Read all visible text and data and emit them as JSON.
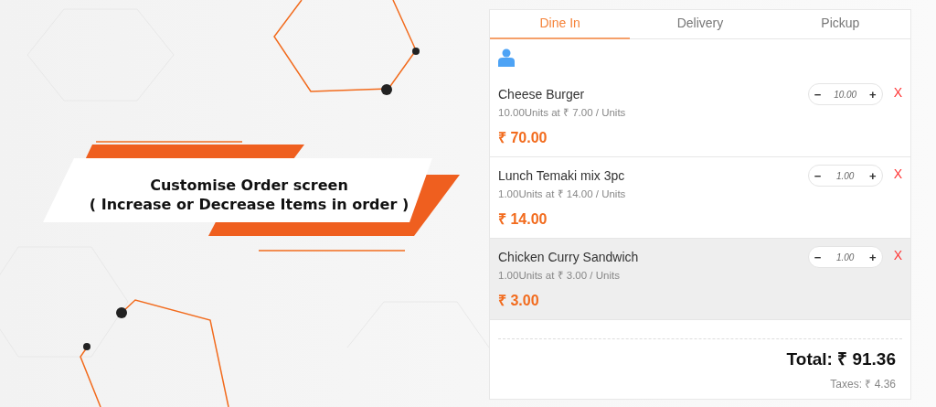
{
  "banner": {
    "title": "Customise Order screen",
    "subtitle": "( Increase or Decrease Items in order )"
  },
  "tabs": [
    {
      "label": "Dine In",
      "selected": true
    },
    {
      "label": "Delivery",
      "selected": false
    },
    {
      "label": "Pickup",
      "selected": false
    }
  ],
  "items": [
    {
      "name": "Cheese Burger",
      "qty_label": "10.00",
      "unit_text": "Units at ₹ 7.00 / Units",
      "price": "₹ 70.00",
      "quantity": "10.00",
      "minus": "−",
      "plus": "+",
      "remove": "X",
      "selected": false
    },
    {
      "name": "Lunch Temaki mix 3pc",
      "qty_label": "1.00",
      "unit_text": "Units at ₹ 14.00 / Units",
      "price": "₹ 14.00",
      "quantity": "1.00",
      "minus": "−",
      "plus": "+",
      "remove": "X",
      "selected": false
    },
    {
      "name": "Chicken Curry Sandwich",
      "qty_label": "1.00",
      "unit_text": "Units at ₹ 3.00 / Units",
      "price": "₹ 3.00",
      "quantity": "1.00",
      "minus": "−",
      "plus": "+",
      "remove": "X",
      "selected": true
    }
  ],
  "total": "Total: ₹ 91.36",
  "taxes": "Taxes: ₹ 4.36"
}
